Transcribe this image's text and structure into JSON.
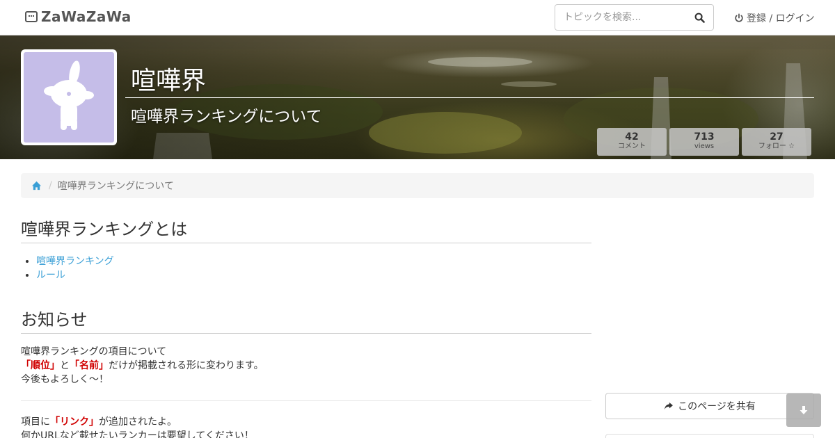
{
  "navbar": {
    "logo_text": "ZaWaZaWa",
    "search_placeholder": "トピックを検索...",
    "login_label": "登録 / ログイン"
  },
  "hero": {
    "title": "喧嘩界",
    "subtitle": "喧嘩界ランキングについて",
    "stats": [
      {
        "value": "42",
        "label": "コメント"
      },
      {
        "value": "713",
        "label": "views"
      },
      {
        "value": "27",
        "label": "フォロー ☆"
      }
    ]
  },
  "breadcrumb": {
    "current": "喧嘩界ランキングについて"
  },
  "main": {
    "section1_title": "喧嘩界ランキングとは",
    "links": [
      "喧嘩界ランキング",
      "ルール"
    ],
    "section2_title": "お知らせ",
    "notice1": {
      "line1": "喧嘩界ランキングの項目について",
      "rank": "「順位」",
      "and": "と",
      "name": "「名前」",
      "line2_rest": "だけが掲載される形に変わります。",
      "line3": "今後もよろしく～！"
    },
    "notice2": {
      "prefix": "項目に",
      "link": "「リンク」",
      "suffix": "が追加されたよ。",
      "line2": "何かURLなど載せたいランカーは要望してください！"
    }
  },
  "sidebar": {
    "share_label": "このページを共有"
  },
  "colors": {
    "link": "#3a9fd6",
    "highlight": "#d00000",
    "avatar_bg": "#c5bde8"
  }
}
